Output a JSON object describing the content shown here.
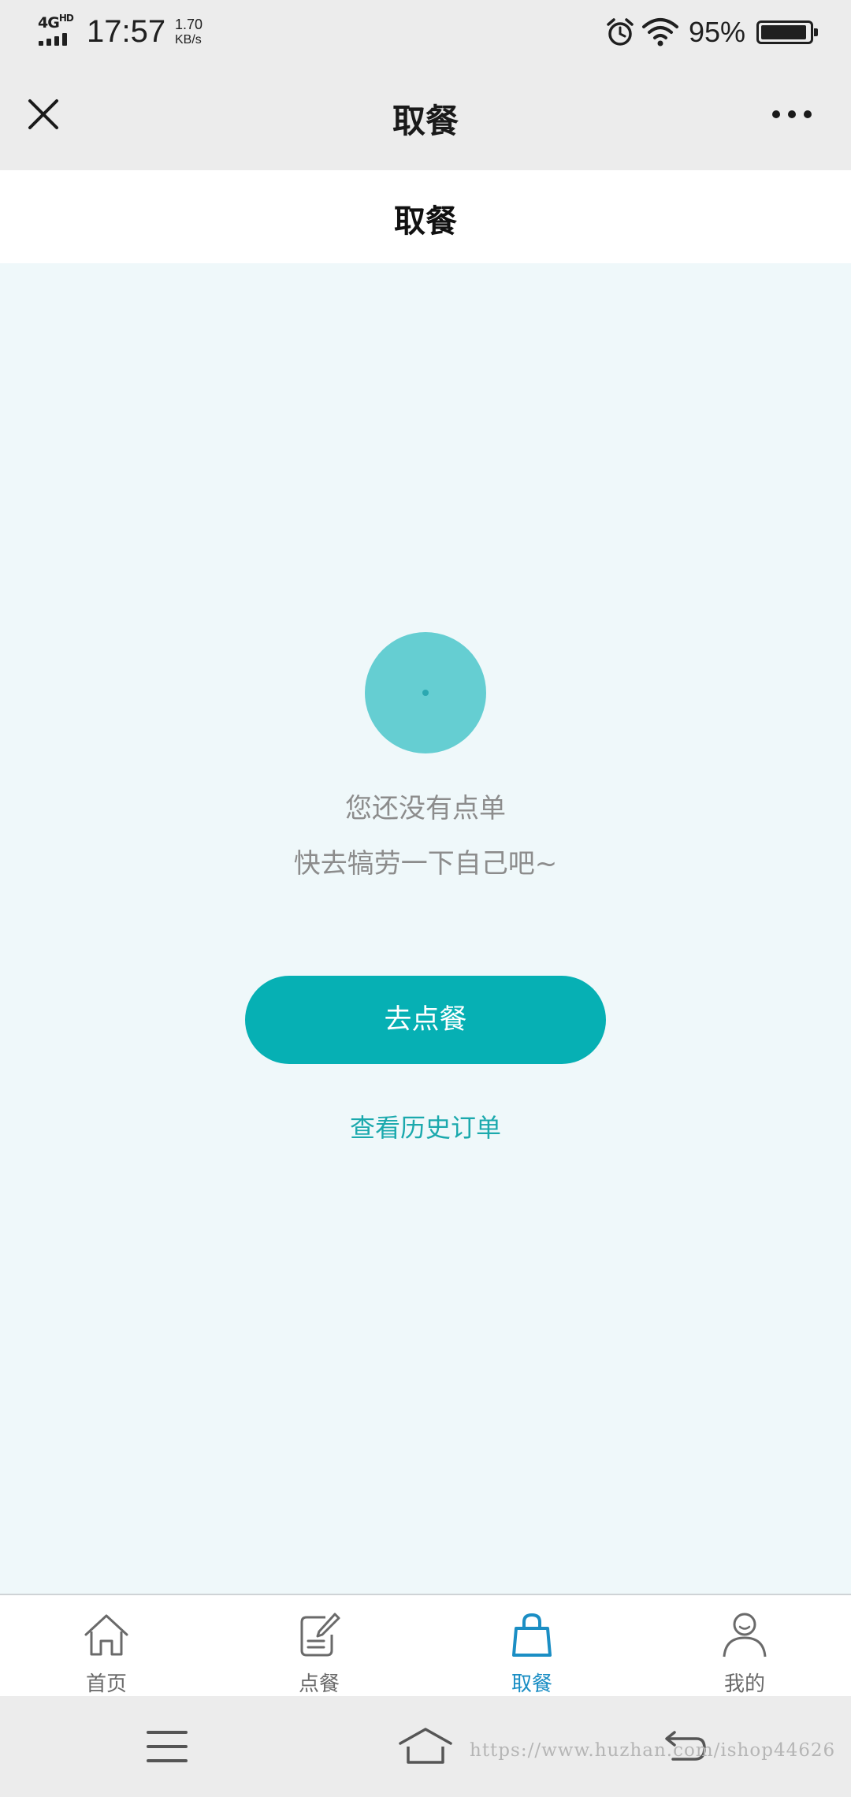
{
  "status_bar": {
    "network": "4G",
    "network_sup": "HD",
    "time": "17:57",
    "net_speed": "1.70",
    "net_speed_unit": "KB/s",
    "battery_percent": "95%",
    "battery_level": 0.95,
    "icons": [
      "signal-icon",
      "alarm-icon",
      "wifi-icon",
      "battery-icon"
    ]
  },
  "nav_bar": {
    "title": "取餐",
    "icons": [
      "close-icon",
      "more-icon"
    ]
  },
  "page_header": {
    "title": "取餐"
  },
  "empty_state": {
    "line_1": "您还没有点单",
    "line_2": "快去犒劳一下自己吧~",
    "order_button": "去点餐",
    "history_link": "查看历史订单"
  },
  "tab_bar": {
    "tabs": [
      {
        "label": "首页",
        "icon": "home-icon",
        "active": false
      },
      {
        "label": "点餐",
        "icon": "order-edit-icon",
        "active": false
      },
      {
        "label": "取餐",
        "icon": "shopping-bag-icon",
        "active": true
      },
      {
        "label": "我的",
        "icon": "user-icon",
        "active": false
      }
    ]
  },
  "system_nav": {
    "icons": [
      "menu-icon",
      "home-icon",
      "back-icon"
    ],
    "watermark": "https://www.huzhan.com/ishop44626"
  },
  "colors": {
    "accent": "#06b0b4",
    "tab_active": "#1b8ec4",
    "illustration": "#65ced2",
    "background": "#eff8fa"
  }
}
